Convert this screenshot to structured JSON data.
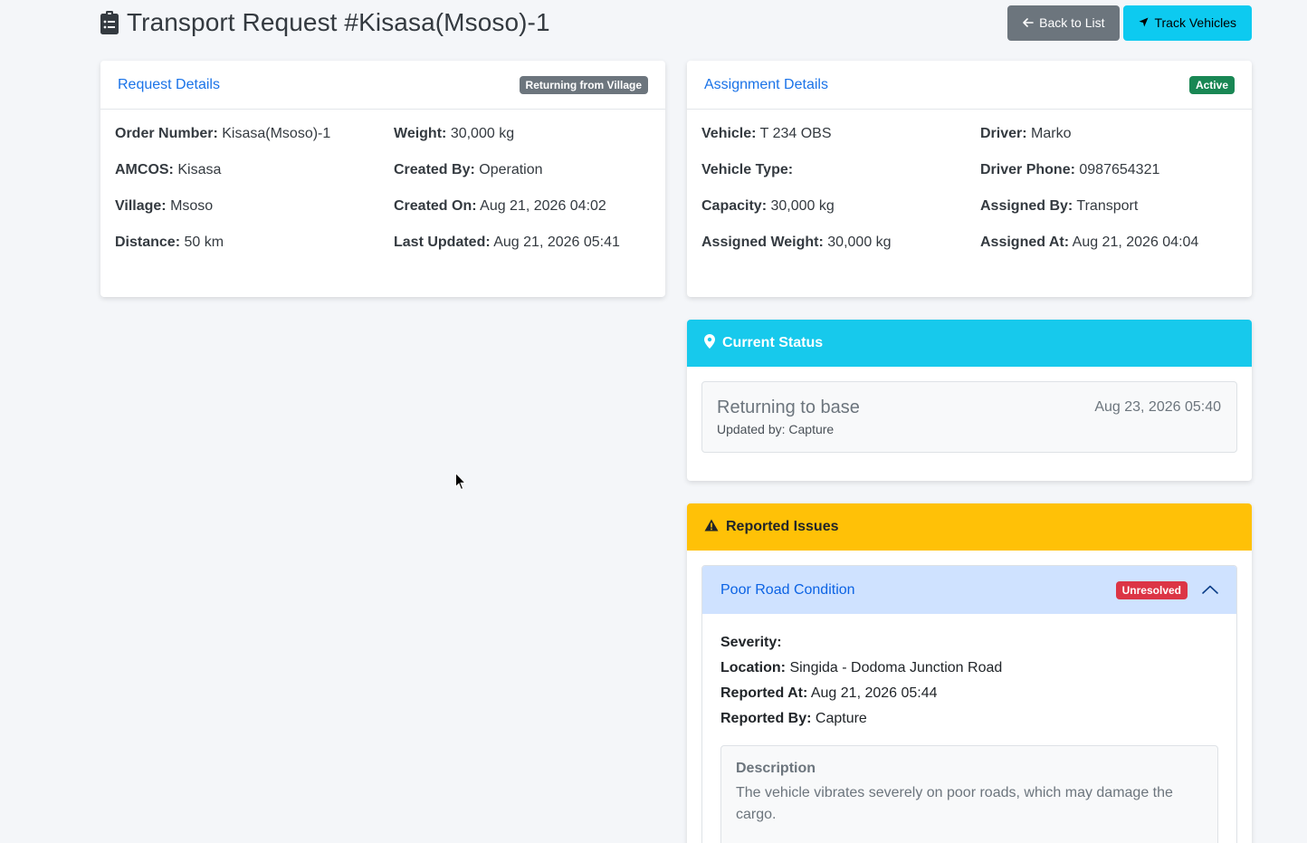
{
  "header": {
    "icon": "clipboard-list-icon",
    "title": "Transport Request #Kisasa(Msoso)-1",
    "back_label": "Back to List",
    "track_label": "Track Vehicles"
  },
  "request": {
    "title": "Request Details",
    "badge": "Returning from Village",
    "order_label": "Order Number:",
    "order_value": "Kisasa(Msoso)-1",
    "weight_label": "Weight:",
    "weight_value": "30,000 kg",
    "amcos_label": "AMCOS:",
    "amcos_value": "Kisasa",
    "created_by_label": "Created By:",
    "created_by_value": "Operation",
    "village_label": "Village:",
    "village_value": "Msoso",
    "created_on_label": "Created On:",
    "created_on_value": "Aug 21, 2026 04:02",
    "distance_label": "Distance:",
    "distance_value": "50 km",
    "updated_label": "Last Updated:",
    "updated_value": "Aug 21, 2026 05:41"
  },
  "assignment": {
    "title": "Assignment Details",
    "badge": "Active",
    "vehicle_label": "Vehicle:",
    "vehicle_value": "T 234 OBS",
    "driver_label": "Driver:",
    "driver_value": "Marko",
    "vtype_label": "Vehicle Type:",
    "vtype_value": "",
    "phone_label": "Driver Phone:",
    "phone_value": "0987654321",
    "capacity_label": "Capacity:",
    "capacity_value": "30,000 kg",
    "assigned_by_label": "Assigned By:",
    "assigned_by_value": "Transport",
    "aweight_label": "Assigned Weight:",
    "aweight_value": "30,000 kg",
    "assigned_at_label": "Assigned At:",
    "assigned_at_value": "Aug 21, 2026 04:04"
  },
  "status": {
    "title": "Current Status",
    "main": "Returning to base",
    "updated_by": "Updated by: Capture",
    "time": "Aug 23, 2026 05:40"
  },
  "issues": {
    "title": "Reported Issues",
    "issue_title": "Poor Road Condition",
    "issue_badge": "Unresolved",
    "severity_label": "Severity:",
    "severity_value": "",
    "location_label": "Location:",
    "location_value": "Singida - Dodoma Junction Road",
    "reported_at_label": "Reported At:",
    "reported_at_value": "Aug 21, 2026 05:44",
    "reported_by_label": "Reported By:",
    "reported_by_value": "Capture",
    "desc_title": "Description",
    "desc_text": "The vehicle vibrates severely on poor roads, which may damage the cargo."
  },
  "colors": {
    "primary": "#1a73e8",
    "info": "#0dcaf0",
    "warning": "#ffc107",
    "success": "#198754",
    "danger": "#dc3545",
    "secondary": "#6c757d"
  }
}
